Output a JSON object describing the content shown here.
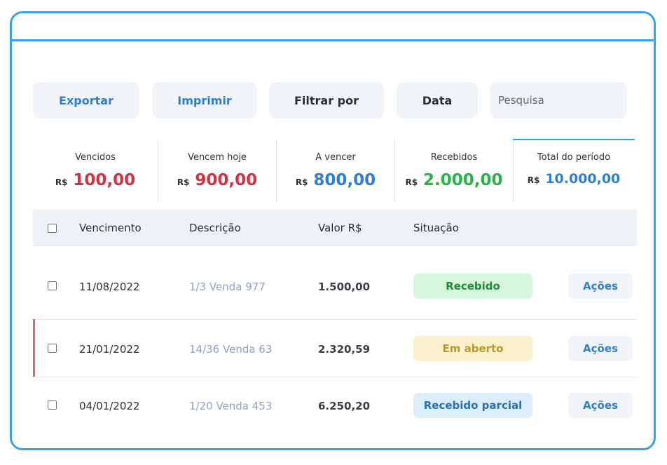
{
  "toolbar": {
    "export_label": "Exportar",
    "print_label": "Imprimir",
    "filter_label": "Filtrar por",
    "date_label": "Data",
    "search_placeholder": "Pesquisa"
  },
  "summary": [
    {
      "label": "Vencidos",
      "currency": "R$",
      "value": "100,00",
      "color": "#d8313d"
    },
    {
      "label": "Vencem hoje",
      "currency": "R$",
      "value": "900,00",
      "color": "#d8313d"
    },
    {
      "label": "A vencer",
      "currency": "R$",
      "value": "800,00",
      "color": "#2f7fd1"
    },
    {
      "label": "Recebidos",
      "currency": "R$",
      "value": "2.000,00",
      "color": "#29b34a"
    },
    {
      "label": "Total do período",
      "currency": "R$",
      "value": "10.000,00",
      "color": "#2f7fd1"
    }
  ],
  "table": {
    "headers": {
      "due": "Vencimento",
      "description": "Descrição",
      "value": "Valor R$",
      "status": "Situação"
    },
    "rows": [
      {
        "due": "11/08/2022",
        "description": "1/3 Venda 977",
        "value": "1.500,00",
        "status": "Recebido",
        "status_bg": "#d7f7dc",
        "status_color": "#1f8a3a",
        "actions": "Ações"
      },
      {
        "due": "21/01/2022",
        "description": "14/36 Venda 63",
        "value": "2.320,59",
        "status": "Em aberto",
        "status_bg": "#fbf0cc",
        "status_color": "#b89a2a",
        "actions": "Ações"
      },
      {
        "due": "04/01/2022",
        "description": "1/20 Venda 453",
        "value": "6.250,20",
        "status": "Recebido parcial",
        "status_bg": "#dceefb",
        "status_color": "#2a6fb8",
        "actions": "Ações"
      }
    ]
  },
  "colors": {
    "accent": "#3aa3e3",
    "overdue_flag": "#e0636e"
  }
}
